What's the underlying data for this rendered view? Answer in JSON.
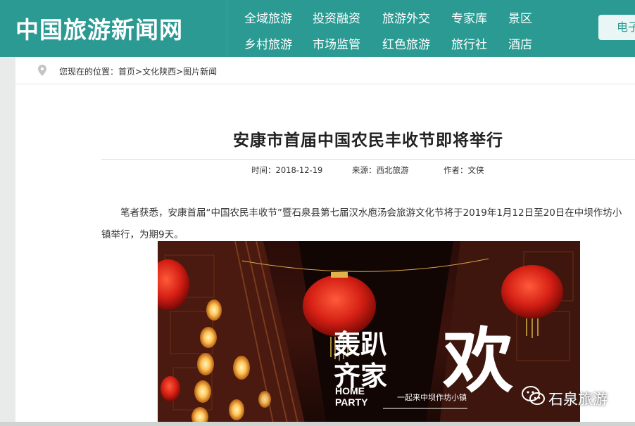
{
  "site": {
    "logo": "中国旅游新闻网"
  },
  "nav": {
    "row1": [
      "全域旅游",
      "投资融资",
      "旅游外交",
      "专家库",
      "景区"
    ],
    "row2": [
      "乡村旅游",
      "市场监管",
      "红色旅游",
      "旅行社",
      "酒店"
    ],
    "e_button": "电子"
  },
  "breadcrumb": {
    "prefix": "您现在的位置：",
    "items": [
      "首页",
      "文化陕西",
      "图片新闻"
    ],
    "sep": ">"
  },
  "article": {
    "title": "安康市首届中国农民丰收节即将举行",
    "time_label": "时间：",
    "time": "2018-12-19",
    "source_label": "来源：",
    "source": "西北旅游",
    "author_label": "作者：",
    "author": "文侠",
    "paragraph": "笔者获悉，安康首届“中国农民丰收节”暨石泉县第七届汉水庖汤会旅游文化节将于2019年1月12日至20日在中坝作坊小镇举行，为期9天。"
  },
  "image": {
    "headline_a": "轰趴",
    "headline_b": "齐家",
    "headline_big": "欢",
    "home": "HOME",
    "party": "PARTY",
    "slogan": "一起来中坝作坊小镇"
  },
  "watermark": {
    "text": "石泉旅游"
  },
  "colors": {
    "brand": "#2a9a93",
    "accent_red": "#c8241d"
  }
}
